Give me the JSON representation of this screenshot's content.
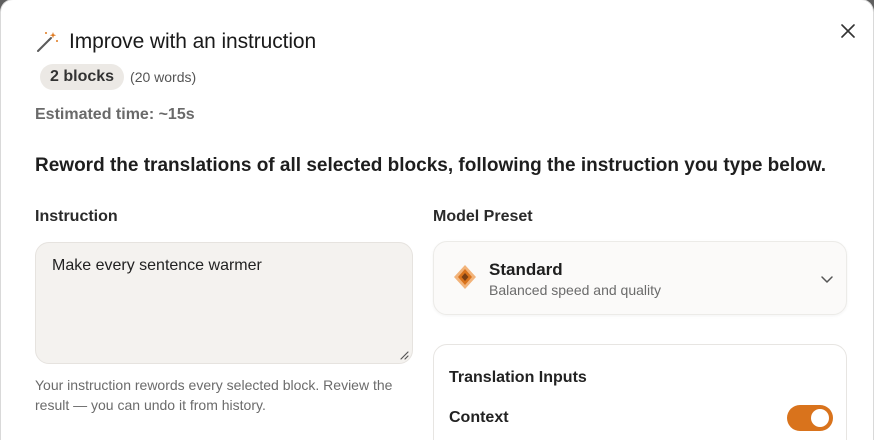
{
  "dialog": {
    "title": "Improve with an instruction",
    "blocks_badge": "2 blocks",
    "words": "(20 words)",
    "estimated_time": "Estimated time: ~15s",
    "description": "Reword the translations of all selected blocks, following the instruction you type below."
  },
  "instruction": {
    "label": "Instruction",
    "value": "Make every sentence warmer",
    "help": "Your instruction rewords every selected block. Review the result — you can undo it from history."
  },
  "model_preset": {
    "label": "Model Preset",
    "selected_name": "Standard",
    "selected_description": "Balanced speed and quality"
  },
  "translation_inputs": {
    "title": "Translation Inputs",
    "context_label": "Context",
    "context_enabled": true
  },
  "icons": {
    "title_icon": "magic-wand-icon",
    "close": "close-icon",
    "preset_icon": "diamond-icon",
    "dropdown": "chevron-down-icon",
    "resize": "resize-handle-icon"
  },
  "colors": {
    "accent": "#d9731c",
    "badge_bg": "#ece9e5",
    "textarea_bg": "#f4f2ef"
  }
}
